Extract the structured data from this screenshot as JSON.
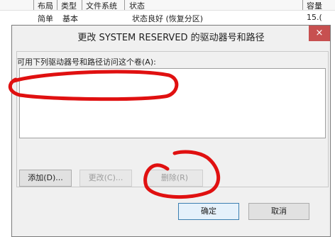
{
  "background": {
    "headers": [
      "布局",
      "类型",
      "文件系统",
      "状态",
      "容量"
    ],
    "row": {
      "layout": "简单",
      "type": "基本",
      "status": "状态良好 (恢复分区)",
      "capacity": "15.("
    }
  },
  "dialog": {
    "title": "更改 SYSTEM RESERVED 的驱动器号和路径",
    "close_glyph": "×",
    "list_label": "可用下列驱动器号和路径访问这个卷(A):",
    "buttons": {
      "add": "添加(D)...",
      "change": "更改(C)...",
      "delete": "删除(R)",
      "ok": "确定",
      "cancel": "取消"
    }
  },
  "colors": {
    "annotation": "#e01010",
    "close_bg": "#c75050"
  }
}
